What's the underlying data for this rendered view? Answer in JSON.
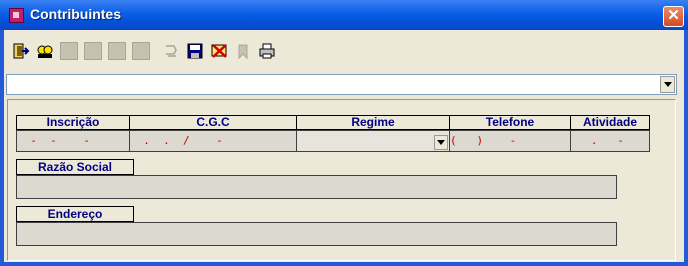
{
  "window": {
    "title": "Contribuintes",
    "close_glyph": "✕"
  },
  "toolbar": {
    "buttons": [
      {
        "icon": "exit-door-icon",
        "enabled": true
      },
      {
        "icon": "search-binoculars-icon",
        "enabled": true
      },
      {
        "icon": "first-record-icon",
        "enabled": false
      },
      {
        "icon": "previous-record-icon",
        "enabled": false
      },
      {
        "icon": "next-record-icon",
        "enabled": false
      },
      {
        "icon": "last-record-icon",
        "enabled": false
      },
      {
        "icon": "undo-icon",
        "enabled": false
      },
      {
        "icon": "save-disk-icon",
        "enabled": true
      },
      {
        "icon": "delete-cancel-icon",
        "enabled": true
      },
      {
        "icon": "bookmark-icon",
        "enabled": false
      },
      {
        "icon": "print-icon",
        "enabled": true
      }
    ]
  },
  "selector": {
    "value": ""
  },
  "table": {
    "headers": {
      "inscricao": "Inscrição",
      "cgc": "C.G.C",
      "regime": "Regime",
      "telefone": "Telefone",
      "atividade": "Atividade"
    },
    "values": {
      "inscricao": "  -  -    -",
      "cgc": "  .  .  /    -",
      "regime": "",
      "telefone": "(   )    -",
      "atividade": "   .   -"
    }
  },
  "razao_social": {
    "label": "Razão Social",
    "value": ""
  },
  "endereco": {
    "label": "Endereço",
    "value": ""
  },
  "colors": {
    "title_bar": "#0a5ee6",
    "label_text": "#000080",
    "mask_text": "#c00000",
    "close_button": "#d64a22"
  }
}
